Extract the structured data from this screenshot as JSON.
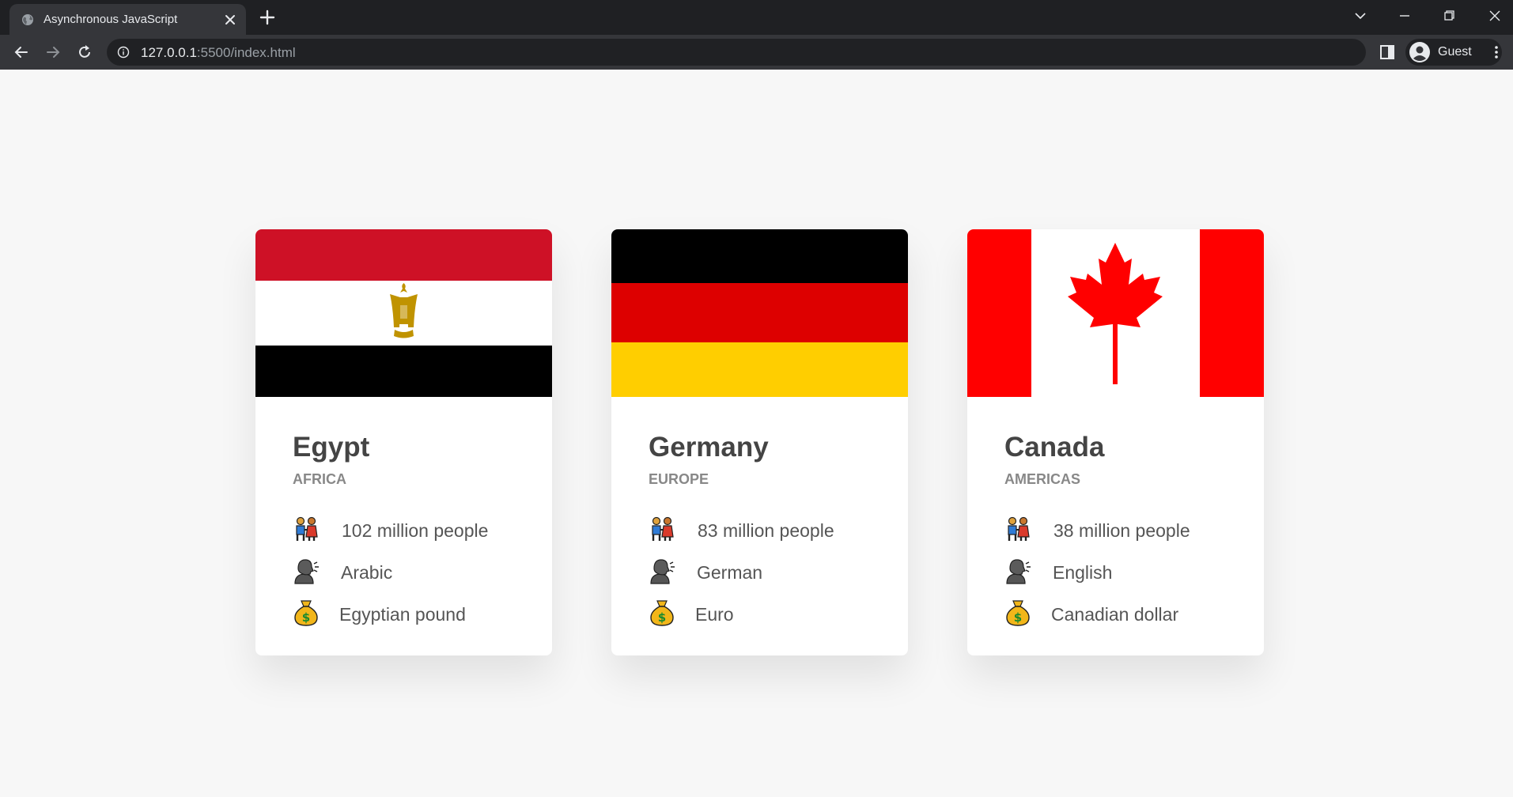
{
  "browser": {
    "tab_title": "Asynchronous JavaScript",
    "url_host": "127.0.0.1",
    "url_rest": ":5500/index.html",
    "profile_label": "Guest"
  },
  "countries": [
    {
      "name": "Egypt",
      "region": "AFRICA",
      "population": "102 million people",
      "language": "Arabic",
      "currency": "Egyptian pound",
      "flag": "egypt-flag"
    },
    {
      "name": "Germany",
      "region": "EUROPE",
      "population": "83 million people",
      "language": "German",
      "currency": "Euro",
      "flag": "germany-flag"
    },
    {
      "name": "Canada",
      "region": "AMERICAS",
      "population": "38 million people",
      "language": "English",
      "currency": "Canadian dollar",
      "flag": "canada-flag"
    }
  ],
  "icons": {
    "population": "people-holding-hands-icon",
    "language": "speaking-head-icon",
    "currency": "money-bag-icon"
  }
}
